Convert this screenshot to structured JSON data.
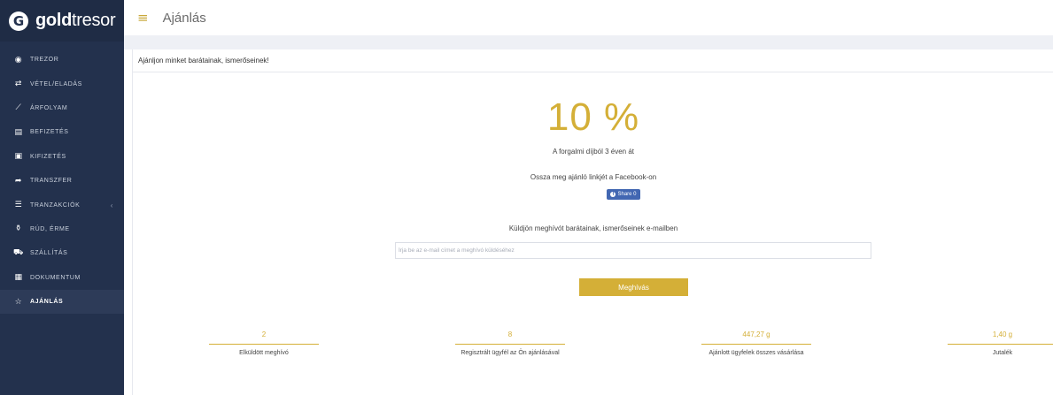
{
  "brand": {
    "mark": "G",
    "bold": "gold",
    "light": "tresor"
  },
  "topbar": {
    "menu_icon": "hamburger-icon",
    "title": "Ajánlás"
  },
  "sidebar": {
    "items": [
      {
        "label": "TREZOR",
        "icon": "vault-icon",
        "glyph": "◉"
      },
      {
        "label": "VÉTEL/ELADÁS",
        "icon": "exchange-icon",
        "glyph": "⇄"
      },
      {
        "label": "ÁRFOLYAM",
        "icon": "chart-icon",
        "glyph": "⟋"
      },
      {
        "label": "BEFIZETÉS",
        "icon": "card-icon",
        "glyph": "▤"
      },
      {
        "label": "KIFIZETÉS",
        "icon": "money-icon",
        "glyph": "▣"
      },
      {
        "label": "TRANSZFER",
        "icon": "share-arrow-icon",
        "glyph": "➦"
      },
      {
        "label": "TRANZAKCIÓK",
        "icon": "list-icon",
        "glyph": "☰",
        "caret": "‹"
      },
      {
        "label": "RÚD, ÉRME",
        "icon": "bars-icon",
        "glyph": "⚱"
      },
      {
        "label": "SZÁLLÍTÁS",
        "icon": "truck-icon",
        "glyph": "⛟"
      },
      {
        "label": "DOKUMENTUM",
        "icon": "document-icon",
        "glyph": "▦"
      },
      {
        "label": "AJÁNLÁS",
        "icon": "star-icon",
        "glyph": "☆",
        "active": true
      }
    ]
  },
  "card": {
    "header": "Ajánljon minket barátainak, ismerőseinek!",
    "percent": "10 %",
    "percent_sub": "A forgalmi díjból 3 éven át",
    "facebook_text": "Ossza meg ajánló linkjét a Facebook-on",
    "share_button": "Share 0",
    "email_text": "Küldjön meghívót barátainak, ismerőseinek e-mailben",
    "email_placeholder": "Írja be az e-mail címet a meghívó küldéséhez",
    "email_value": "",
    "invite_button": "Meghívás"
  },
  "stats": [
    {
      "value": "2",
      "label": "Elküldött meghívó"
    },
    {
      "value": "8",
      "label": "Regisztrált ügyfél az Ön ajánlásával"
    },
    {
      "value": "447,27 g",
      "label": "Ajánlott ügyfelek összes vásárlása"
    },
    {
      "value": "1,40 g",
      "label": "Jutalék"
    }
  ],
  "colors": {
    "gold": "#d4af37",
    "sidebar": "#23314d",
    "facebook": "#4267b2"
  }
}
